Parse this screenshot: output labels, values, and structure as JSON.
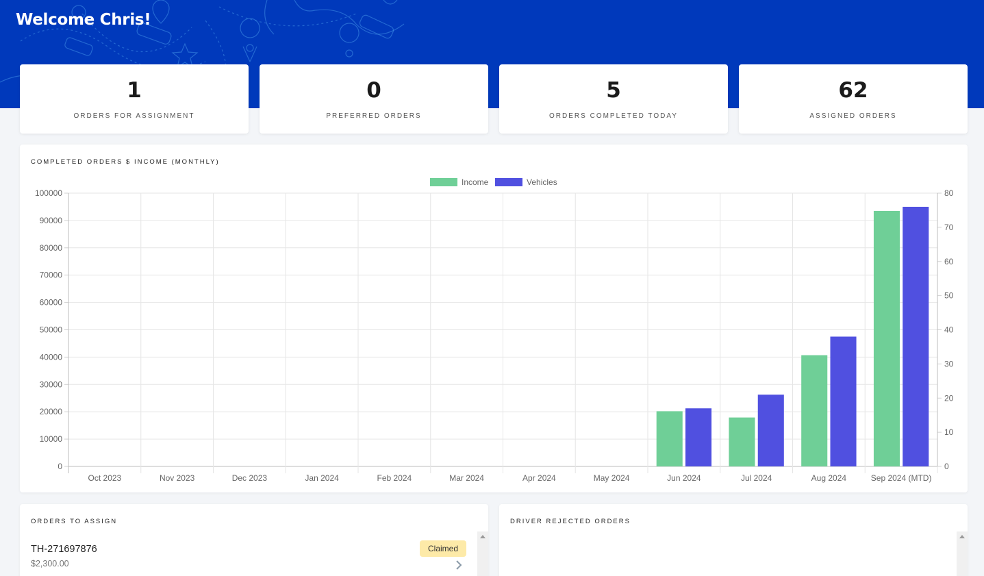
{
  "header": {
    "welcome": "Welcome Chris!"
  },
  "stats": [
    {
      "value": "1",
      "label": "ORDERS FOR ASSIGNMENT"
    },
    {
      "value": "0",
      "label": "PREFERRED ORDERS"
    },
    {
      "value": "5",
      "label": "ORDERS COMPLETED TODAY"
    },
    {
      "value": "62",
      "label": "ASSIGNED ORDERS"
    }
  ],
  "chart_panel": {
    "title": "COMPLETED ORDERS $ INCOME (MONTHLY)"
  },
  "chart_data": {
    "type": "bar",
    "categories": [
      "Oct 2023",
      "Nov 2023",
      "Dec 2023",
      "Jan 2024",
      "Feb 2024",
      "Mar 2024",
      "Apr 2024",
      "May 2024",
      "Jun 2024",
      "Jul 2024",
      "Aug 2024",
      "Sep 2024 (MTD)"
    ],
    "series": [
      {
        "name": "Income",
        "axis": "left",
        "color": "#6fcf97",
        "values": [
          0,
          0,
          0,
          0,
          0,
          0,
          0,
          0,
          20200,
          17900,
          40700,
          93500
        ]
      },
      {
        "name": "Vehicles",
        "axis": "right",
        "color": "#5050e0",
        "values": [
          0,
          0,
          0,
          0,
          0,
          0,
          0,
          0,
          17,
          21,
          38,
          76
        ]
      }
    ],
    "y_left": {
      "min": 0,
      "max": 100000,
      "ticks": [
        "0",
        "10000",
        "20000",
        "30000",
        "40000",
        "50000",
        "60000",
        "70000",
        "80000",
        "90000",
        "100000"
      ]
    },
    "y_right": {
      "min": 0,
      "max": 80,
      "ticks": [
        "0",
        "10",
        "20",
        "30",
        "40",
        "50",
        "60",
        "70",
        "80"
      ]
    },
    "grid": true,
    "legend": "top-center"
  },
  "orders_to_assign": {
    "title": "ORDERS TO ASSIGN",
    "items": [
      {
        "id": "TH-271697876",
        "price": "$2,300.00",
        "status": "Claimed"
      }
    ]
  },
  "driver_rejected": {
    "title": "DRIVER REJECTED ORDERS"
  },
  "colors": {
    "header_bg": "#0039bb",
    "badge_bg": "#fdeaa8",
    "income": "#6fcf97",
    "vehicles": "#5050e0"
  },
  "icons": [
    "chevron-right-icon",
    "scroll-up-arrow-icon"
  ]
}
